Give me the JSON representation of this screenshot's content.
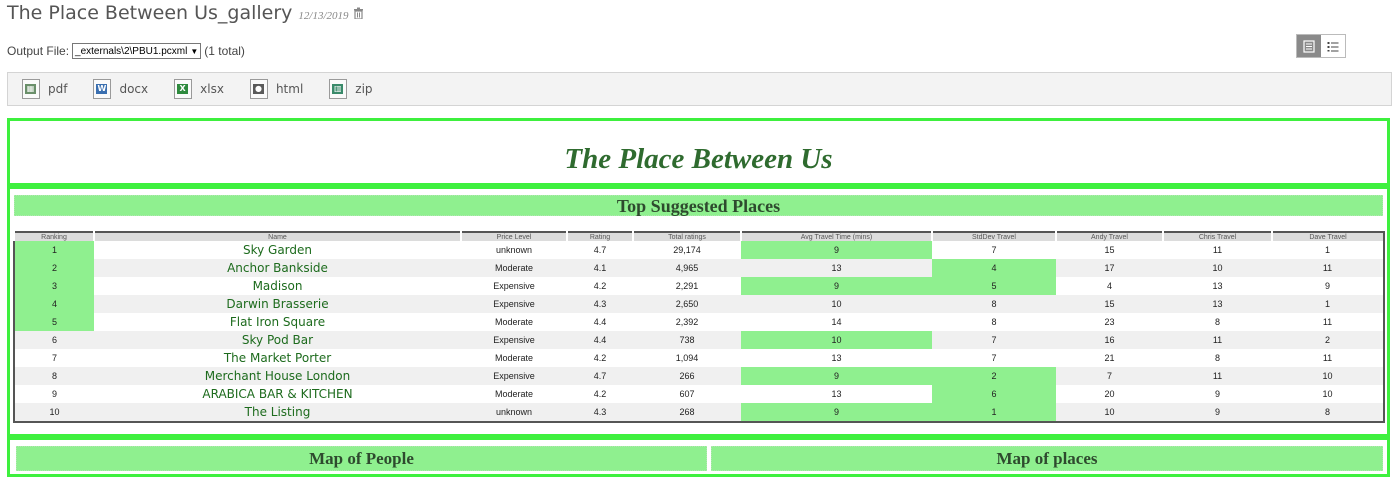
{
  "header": {
    "title": "The Place Between Us_gallery",
    "date": "12/13/2019",
    "trash_icon": "trash-icon"
  },
  "output": {
    "label": "Output File:",
    "selected": "_externals\\2\\PBU1.pcxml",
    "total": "(1 total)"
  },
  "view_toggle": {
    "grid_icon": "grid-view-icon",
    "list_icon": "list-view-icon"
  },
  "exports": [
    {
      "label": "pdf",
      "icon": "pdf-file-icon",
      "color": "#6a8f6a",
      "glyph": "▦"
    },
    {
      "label": "docx",
      "icon": "word-file-icon",
      "color": "#3a6fb0",
      "glyph": "W"
    },
    {
      "label": "xlsx",
      "icon": "excel-file-icon",
      "color": "#2e8a3e",
      "glyph": "X"
    },
    {
      "label": "html",
      "icon": "html-file-icon",
      "color": "#5a5a5a",
      "glyph": "●"
    },
    {
      "label": "zip",
      "icon": "zip-file-icon",
      "color": "#3a8a6a",
      "glyph": "▥"
    }
  ],
  "report": {
    "title": "The Place Between Us",
    "top_places_title": "Top Suggested Places",
    "map_people_title": "Map of People",
    "map_places_title": "Map of places"
  },
  "table": {
    "columns": [
      "Ranking",
      "Name",
      "Price Level",
      "Rating",
      "Total ratings",
      "Avg Travel Time (mins)",
      "StdDev Travel",
      "Andy Travel",
      "Chris Travel",
      "Dave Travel"
    ],
    "rows": [
      {
        "rank": "1",
        "name": "Sky Garden",
        "price": "unknown",
        "rating": "4.7",
        "total": "29,174",
        "avg": "9",
        "std": "7",
        "andy": "15",
        "chris": "11",
        "dave": "1",
        "hl_rank": true,
        "hl_avg": true,
        "hl_std": false
      },
      {
        "rank": "2",
        "name": "Anchor Bankside",
        "price": "Moderate",
        "rating": "4.1",
        "total": "4,965",
        "avg": "13",
        "std": "4",
        "andy": "17",
        "chris": "10",
        "dave": "11",
        "hl_rank": true,
        "hl_avg": false,
        "hl_std": true
      },
      {
        "rank": "3",
        "name": "Madison",
        "price": "Expensive",
        "rating": "4.2",
        "total": "2,291",
        "avg": "9",
        "std": "5",
        "andy": "4",
        "chris": "13",
        "dave": "9",
        "hl_rank": true,
        "hl_avg": true,
        "hl_std": true
      },
      {
        "rank": "4",
        "name": "Darwin Brasserie",
        "price": "Expensive",
        "rating": "4.3",
        "total": "2,650",
        "avg": "10",
        "std": "8",
        "andy": "15",
        "chris": "13",
        "dave": "1",
        "hl_rank": true,
        "hl_avg": false,
        "hl_std": false
      },
      {
        "rank": "5",
        "name": "Flat Iron Square",
        "price": "Moderate",
        "rating": "4.4",
        "total": "2,392",
        "avg": "14",
        "std": "8",
        "andy": "23",
        "chris": "8",
        "dave": "11",
        "hl_rank": true,
        "hl_avg": false,
        "hl_std": false
      },
      {
        "rank": "6",
        "name": "Sky Pod Bar",
        "price": "Expensive",
        "rating": "4.4",
        "total": "738",
        "avg": "10",
        "std": "7",
        "andy": "16",
        "chris": "11",
        "dave": "2",
        "hl_rank": false,
        "hl_avg": true,
        "hl_std": false
      },
      {
        "rank": "7",
        "name": "The Market Porter",
        "price": "Moderate",
        "rating": "4.2",
        "total": "1,094",
        "avg": "13",
        "std": "7",
        "andy": "21",
        "chris": "8",
        "dave": "11",
        "hl_rank": false,
        "hl_avg": false,
        "hl_std": false
      },
      {
        "rank": "8",
        "name": "Merchant House London",
        "price": "Expensive",
        "rating": "4.7",
        "total": "266",
        "avg": "9",
        "std": "2",
        "andy": "7",
        "chris": "11",
        "dave": "10",
        "hl_rank": false,
        "hl_avg": true,
        "hl_std": true
      },
      {
        "rank": "9",
        "name": "ARABICA BAR & KITCHEN",
        "price": "Moderate",
        "rating": "4.2",
        "total": "607",
        "avg": "13",
        "std": "6",
        "andy": "20",
        "chris": "9",
        "dave": "10",
        "hl_rank": false,
        "hl_avg": false,
        "hl_std": true
      },
      {
        "rank": "10",
        "name": "The Listing",
        "price": "unknown",
        "rating": "4.3",
        "total": "268",
        "avg": "9",
        "std": "1",
        "andy": "10",
        "chris": "9",
        "dave": "8",
        "hl_rank": false,
        "hl_avg": true,
        "hl_std": true
      }
    ]
  }
}
